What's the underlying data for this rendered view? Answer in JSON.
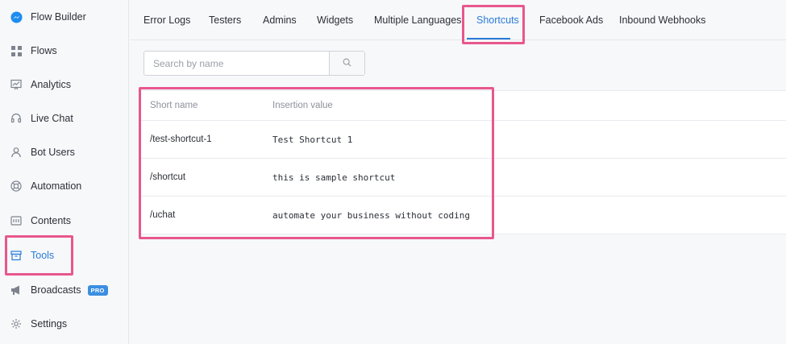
{
  "sidebar": {
    "items": [
      {
        "label": "Flow Builder",
        "icon": "messenger-icon"
      },
      {
        "label": "Flows",
        "icon": "grid-icon"
      },
      {
        "label": "Analytics",
        "icon": "analytics-icon"
      },
      {
        "label": "Live Chat",
        "icon": "headset-icon"
      },
      {
        "label": "Bot Users",
        "icon": "user-icon"
      },
      {
        "label": "Automation",
        "icon": "lifebuoy-icon"
      },
      {
        "label": "Contents",
        "icon": "contents-icon"
      },
      {
        "label": "Tools",
        "icon": "toolbox-icon"
      },
      {
        "label": "Broadcasts",
        "icon": "megaphone-icon",
        "badge": "PRO"
      },
      {
        "label": "Settings",
        "icon": "gear-icon"
      }
    ],
    "active": "Tools"
  },
  "tabs": {
    "items": [
      "Error Logs",
      "Testers",
      "Admins",
      "Widgets",
      "Multiple Languages",
      "Shortcuts",
      "Facebook Ads",
      "Inbound Webhooks"
    ],
    "active": "Shortcuts"
  },
  "search": {
    "placeholder": "Search by name",
    "value": ""
  },
  "table": {
    "columns": [
      "Short name",
      "Insertion value"
    ],
    "rows": [
      {
        "name": "/test-shortcut-1",
        "value": "Test Shortcut 1"
      },
      {
        "name": "/shortcut",
        "value": "this is sample shortcut"
      },
      {
        "name": "/uchat",
        "value": "automate your business without coding"
      }
    ]
  },
  "colors": {
    "accent": "#2a7bd8",
    "highlight": "#e8578d",
    "badge": "#3b8fe0"
  }
}
